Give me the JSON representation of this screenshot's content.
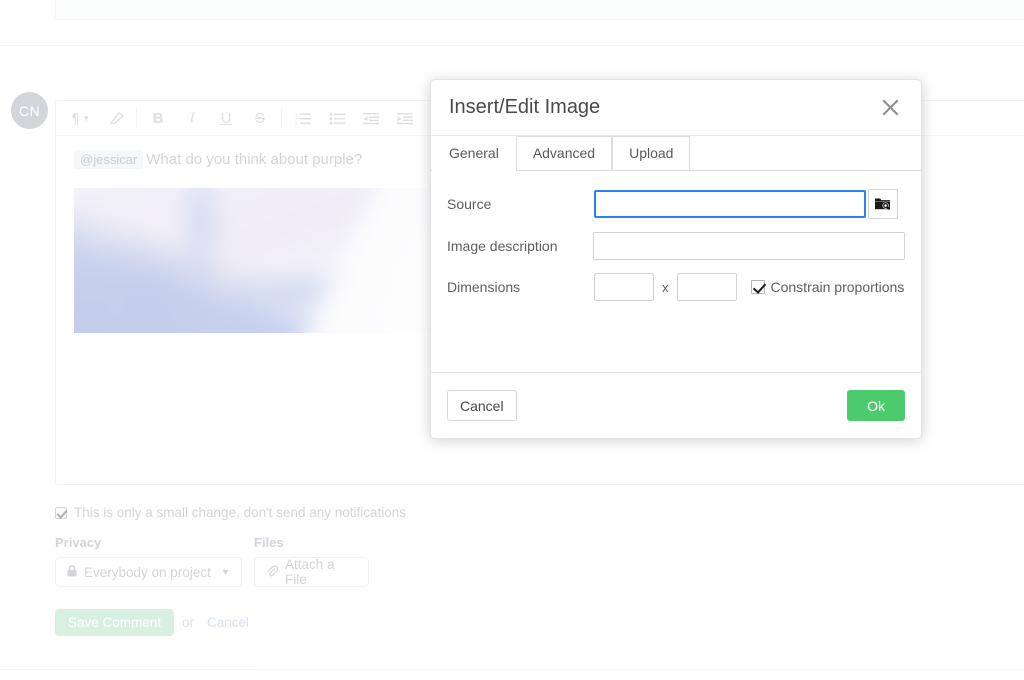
{
  "background": {
    "avatar_initials": "CN",
    "toolbar_items": [
      {
        "name": "paragraph-format-icon",
        "glyph": "¶"
      },
      {
        "name": "clear-formatting-icon",
        "glyph": "eraser"
      },
      {
        "name": "bold-icon",
        "glyph": "B"
      },
      {
        "name": "italic-icon",
        "glyph": "I"
      },
      {
        "name": "underline-icon",
        "glyph": "U"
      },
      {
        "name": "strikethrough-icon",
        "glyph": "S"
      },
      {
        "name": "numbered-list-icon",
        "glyph": "ol"
      },
      {
        "name": "bullet-list-icon",
        "glyph": "ul"
      },
      {
        "name": "outdent-icon",
        "glyph": "outdent"
      },
      {
        "name": "indent-icon",
        "glyph": "indent"
      }
    ],
    "comment": {
      "mention": "@jessicar",
      "text": "What do you think about purple?"
    },
    "notify_checkbox_label": "This is only a small change, don't send any notifications",
    "notify_checked": true,
    "privacy_label": "Privacy",
    "privacy_value": "Everybody on project",
    "files_label": "Files",
    "attach_label": "Attach a File",
    "save_label": "Save Comment",
    "or_text": "or",
    "cancel_label": "Cancel"
  },
  "modal": {
    "title": "Insert/Edit Image",
    "close_label": "×",
    "tabs": [
      {
        "label": "General",
        "active": true
      },
      {
        "label": "Advanced",
        "active": false
      },
      {
        "label": "Upload",
        "active": false
      }
    ],
    "fields": {
      "source_label": "Source",
      "source_value": "",
      "source_placeholder": "",
      "description_label": "Image description",
      "description_value": "",
      "description_placeholder": "",
      "dimensions_label": "Dimensions",
      "width_value": "",
      "height_value": "",
      "dimension_separator": "x",
      "constrain_label": "Constrain proportions",
      "constrain_checked": true
    },
    "buttons": {
      "cancel_label": "Cancel",
      "ok_label": "Ok"
    },
    "colors": {
      "ok_green": "#4ccb6d",
      "focus_blue": "#2d7ff9"
    }
  }
}
